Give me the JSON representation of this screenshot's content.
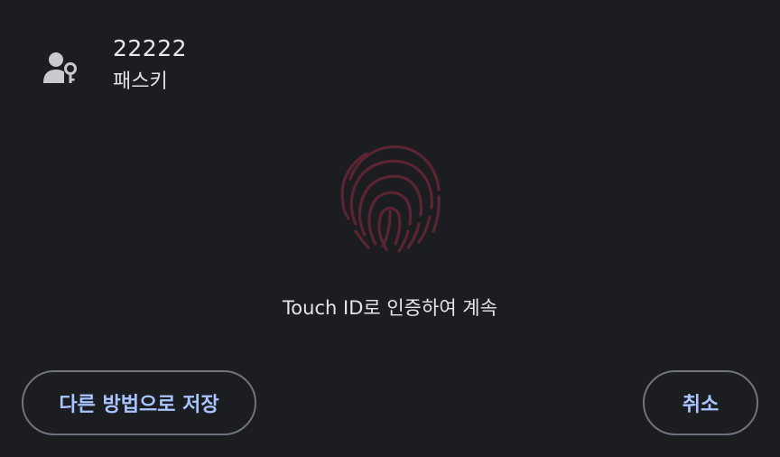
{
  "account": {
    "name": "22222",
    "type": "패스키",
    "icon": "user-key-icon"
  },
  "fingerprint": {
    "icon": "fingerprint-icon",
    "color": "#5a2531"
  },
  "prompt": {
    "text": "Touch ID로 인증하여 계속"
  },
  "buttons": {
    "other_method_label": "다른 방법으로 저장",
    "cancel_label": "취소"
  },
  "colors": {
    "background": "#1c1d21",
    "button_text": "#a9c4ff",
    "button_border": "#6f7380"
  }
}
